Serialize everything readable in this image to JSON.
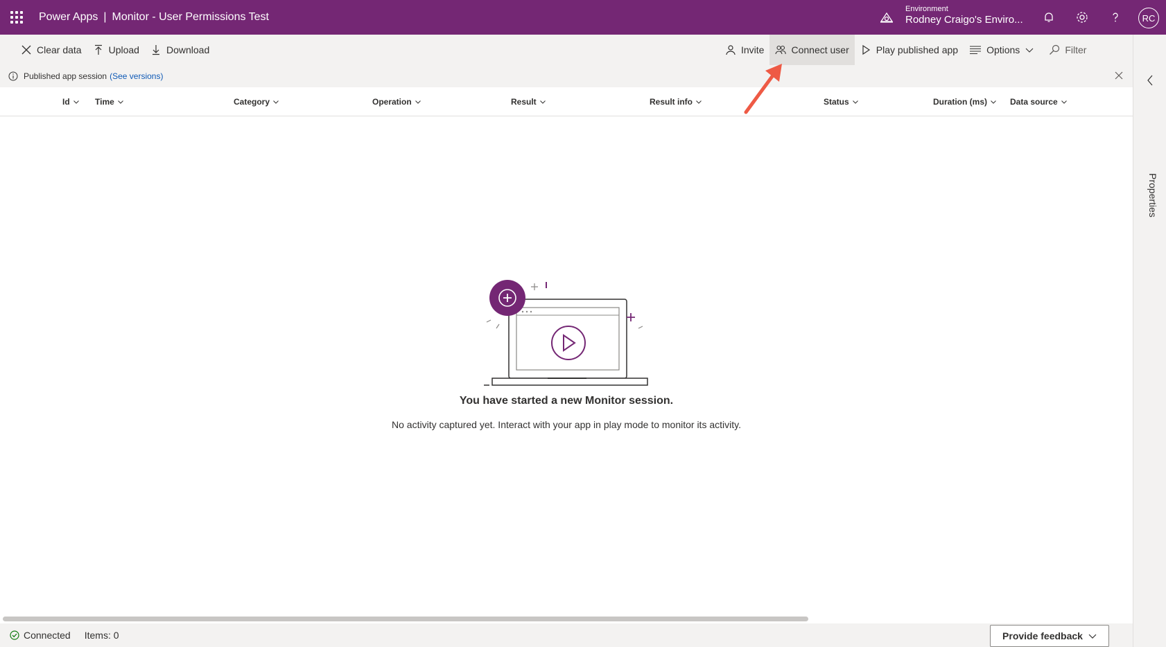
{
  "topbar": {
    "app_name": "Power Apps",
    "separator": "|",
    "page_title": "Monitor - User Permissions Test",
    "environment_label": "Environment",
    "environment_name": "Rodney Craigo's Enviro...",
    "avatar_initials": "RC",
    "brand_color": "#742774"
  },
  "toolbar": {
    "clear_label": "Clear data",
    "upload_label": "Upload",
    "download_label": "Download",
    "invite_label": "Invite",
    "connect_user_label": "Connect user",
    "play_label": "Play published app",
    "options_label": "Options",
    "filter_label": "Filter"
  },
  "infobar": {
    "text": "Published app session",
    "link": "(See versions)"
  },
  "columns": [
    "Id",
    "Time",
    "Category",
    "Operation",
    "Result",
    "Result info",
    "Status",
    "Duration (ms)",
    "Data source"
  ],
  "empty_state": {
    "title": "You have started a new Monitor session.",
    "subtitle": "No activity captured yet. Interact with your app in play mode to monitor its activity."
  },
  "rightpane": {
    "label": "Properties"
  },
  "statusbar": {
    "connection": "Connected",
    "items": "Items: 0",
    "feedback_label": "Provide feedback"
  },
  "icons": [
    "waffle-icon",
    "environment-icon",
    "bell-icon",
    "gear-icon",
    "help-icon",
    "close-icon",
    "upload-icon",
    "download-icon",
    "person-icon",
    "people-icon",
    "play-icon",
    "options-icon",
    "filter-icon",
    "info-icon",
    "chevron-left-icon",
    "check-circle-icon",
    "chevron-down-icon"
  ],
  "annotation_color": "#ee5a45"
}
